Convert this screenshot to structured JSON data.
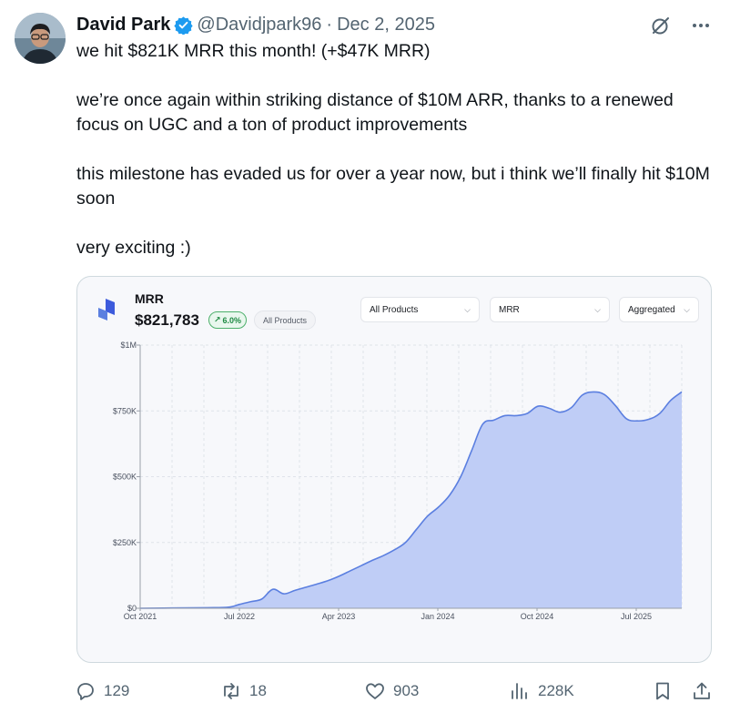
{
  "tweet": {
    "author_name": "David Park",
    "handle": "@Davidjpark96",
    "separator": "·",
    "date": "Dec 2, 2025",
    "paragraphs": [
      "we hit $821K MRR this month! (+$47K MRR)",
      "we’re once again within striking distance of $10M ARR, thanks to a renewed focus on UGC and a ton of product improvements",
      "this milestone has evaded us for over a year now, but i think we’ll finally hit $10M soon",
      "very exciting :)"
    ],
    "verified_color": "#1d9bf0"
  },
  "card": {
    "metric_label": "MRR",
    "metric_value": "$821,783",
    "growth_badge": "6.0%",
    "product_tag": "All Products",
    "dropdowns": [
      "All Products",
      "MRR",
      "Aggregated"
    ],
    "accent_color": "#5b7fe0",
    "fill_color": "#bfcdf6"
  },
  "chart_data": {
    "type": "area",
    "title": "MRR",
    "xlabel": "",
    "ylabel": "",
    "x_tick_labels": [
      "Oct 2021",
      "Jul 2022",
      "Apr 2023",
      "Jan 2024",
      "Oct 2024",
      "Jul 2025"
    ],
    "y_tick_labels": [
      "$0",
      "$250K",
      "$500K",
      "$750K",
      "$1M"
    ],
    "ylim": [
      0,
      1000000
    ],
    "xlim": [
      "2021-10",
      "2025-11"
    ],
    "grid": true,
    "series": [
      {
        "x": [
          "2021-10",
          "2022-01",
          "2022-04",
          "2022-06",
          "2022-07",
          "2022-08",
          "2022-09",
          "2022-10",
          "2022-11",
          "2022-12",
          "2023-01",
          "2023-02",
          "2023-03",
          "2023-04",
          "2023-05",
          "2023-06",
          "2023-07",
          "2023-08",
          "2023-09",
          "2023-10",
          "2023-11",
          "2023-12",
          "2024-01",
          "2024-02",
          "2024-03",
          "2024-04",
          "2024-05",
          "2024-06",
          "2024-07",
          "2024-08",
          "2024-09",
          "2024-10",
          "2024-11",
          "2024-12",
          "2025-01",
          "2025-02",
          "2025-03",
          "2025-04",
          "2025-05",
          "2025-06",
          "2025-07",
          "2025-08",
          "2025-09",
          "2025-10",
          "2025-11"
        ],
        "values": [
          0,
          1000,
          2000,
          4000,
          15000,
          25000,
          35000,
          72000,
          55000,
          68000,
          80000,
          92000,
          105000,
          122000,
          142000,
          162000,
          182000,
          200000,
          222000,
          250000,
          300000,
          350000,
          385000,
          430000,
          500000,
          600000,
          700000,
          715000,
          732000,
          732000,
          740000,
          768000,
          760000,
          745000,
          762000,
          810000,
          822000,
          812000,
          770000,
          720000,
          712000,
          718000,
          740000,
          790000,
          822000
        ]
      }
    ]
  },
  "engagement": {
    "replies": "129",
    "reposts": "18",
    "likes": "903",
    "views": "228K"
  }
}
